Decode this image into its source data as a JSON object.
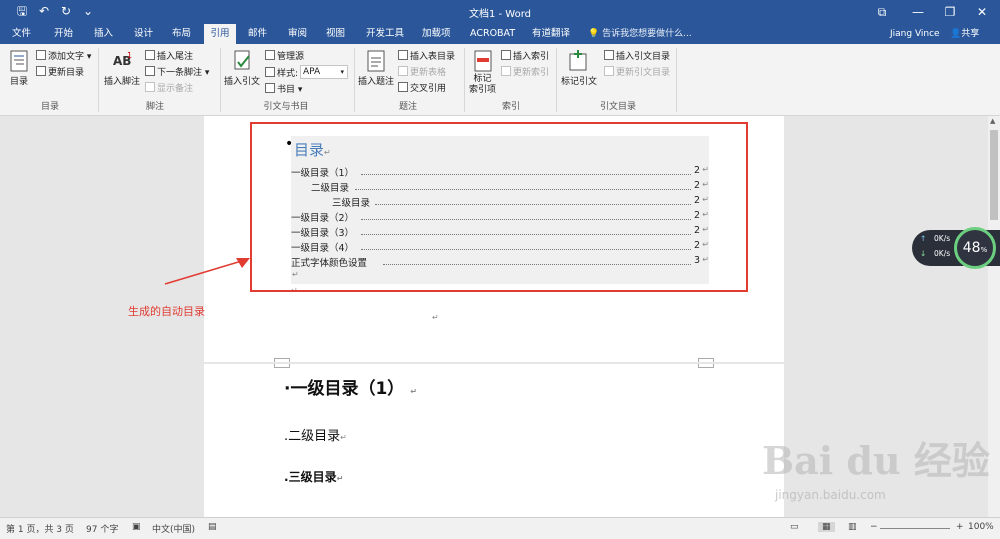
{
  "titlebar": {
    "title": "文档1 - Word",
    "qa_save": "🖫",
    "qa_undo": "↶",
    "qa_redo": "↻",
    "qa_more": "⌄",
    "win_restore": "⧉",
    "win_minimize": "—",
    "win_maximize": "❐",
    "win_close": "✕"
  },
  "tabs": [
    "文件",
    "开始",
    "插入",
    "设计",
    "布局",
    "引用",
    "邮件",
    "审阅",
    "视图",
    "开发工具",
    "加载项",
    "ACROBAT",
    "有道翻译"
  ],
  "active_tab": "引用",
  "tellme": "告诉我您想要做什么...",
  "user": "Jiang Vince",
  "share": "共享",
  "ribbon": {
    "toc_btn": "目录",
    "add_text": "添加文字 ▾",
    "update_toc": "更新目录",
    "group_toc": "目录",
    "insert_footnote": "插入脚注",
    "insert_endnote": "插入尾注",
    "next_footnote": "下一条脚注 ▾",
    "show_notes": "显示备注",
    "group_footnote": "脚注",
    "insert_citation": "插入引文",
    "manage_sources": "管理源",
    "style_label": "样式:",
    "style_value": "APA",
    "bibliography": "书目 ▾",
    "group_citations": "引文与书目",
    "insert_caption": "插入题注",
    "insert_table_of_figures": "插入表目录",
    "update_table": "更新表格",
    "cross_reference": "交叉引用",
    "group_captions": "题注",
    "mark_entry": "标记\n索引项",
    "insert_index": "插入索引",
    "update_index": "更新索引",
    "group_index": "索引",
    "mark_citation": "标记引文",
    "insert_toa": "插入引文目录",
    "update_toa": "更新引文目录",
    "group_toa": "引文目录"
  },
  "document": {
    "toc_title": "目录",
    "toc_entries": [
      {
        "text": "一级目录（1）",
        "page": "2"
      },
      {
        "text": "二级目录",
        "page": "2"
      },
      {
        "text": "三级目录",
        "page": "2"
      },
      {
        "text": "一级目录（2）",
        "page": "2"
      },
      {
        "text": "一级目录（3）",
        "page": "2"
      },
      {
        "text": "一级目录（4）",
        "page": "2"
      },
      {
        "text": "正式字体颜色设置",
        "page": "3"
      }
    ],
    "para_mark": "↵",
    "heading1": "一级目录（1）",
    "heading2": "二级目录",
    "heading3": "三级目录"
  },
  "annotation": "生成的自动目录",
  "netwidget": {
    "up": "0K/s",
    "down": "0K/s",
    "cpu": "48",
    "cpu_unit": "%"
  },
  "statusbar": {
    "page": "第 1 页，共 3 页",
    "words": "97 个字",
    "lang": "中文(中国)",
    "zoom": "100%"
  },
  "watermark": {
    "logo": "Bai du 经验",
    "url": "jingyan.baidu.com"
  },
  "colors": {
    "word_blue": "#2b579a",
    "callout_red": "#e03c31",
    "toc_title_blue": "#4a7ebb"
  }
}
